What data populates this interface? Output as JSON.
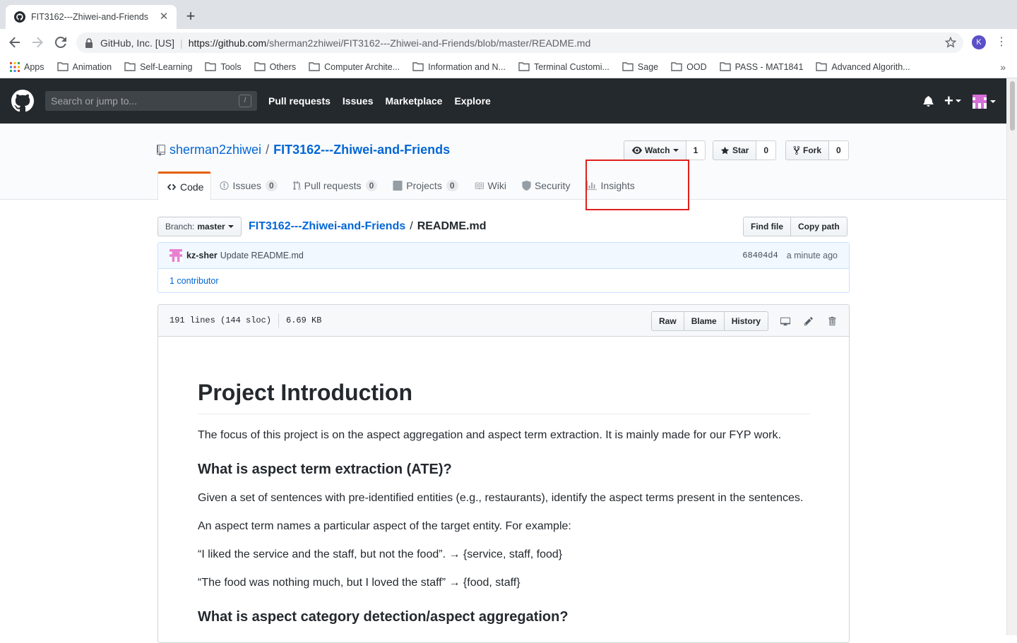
{
  "browser": {
    "tab_title": "FIT3162---Zhiwei-and-Friends",
    "url_org": "GitHub, Inc. [US]",
    "url_host": "https://github.com",
    "url_path": "/sherman2zhiwei/FIT3162---Zhiwei-and-Friends/blob/master/README.md",
    "profile_initial": "K",
    "bookmarks": [
      "Apps",
      "Animation",
      "Self-Learning",
      "Tools",
      "Others",
      "Computer Archite...",
      "Information and N...",
      "Terminal Customi...",
      "Sage",
      "OOD",
      "PASS - MAT1841",
      "Advanced Algorith..."
    ],
    "bookmarks_more": "»"
  },
  "github": {
    "search_placeholder": "Search or jump to...",
    "search_shortcut": "/",
    "nav": [
      "Pull requests",
      "Issues",
      "Marketplace",
      "Explore"
    ]
  },
  "repo": {
    "owner": "sherman2zhiwei",
    "name": "FIT3162---Zhiwei-and-Friends",
    "watch_label": "Watch",
    "watch_count": "1",
    "star_label": "Star",
    "star_count": "0",
    "fork_label": "Fork",
    "fork_count": "0",
    "tabs": [
      {
        "label": "Code",
        "count": null
      },
      {
        "label": "Issues",
        "count": "0"
      },
      {
        "label": "Pull requests",
        "count": "0"
      },
      {
        "label": "Projects",
        "count": "0"
      },
      {
        "label": "Wiki",
        "count": null
      },
      {
        "label": "Security",
        "count": null
      },
      {
        "label": "Insights",
        "count": null
      }
    ]
  },
  "filenav": {
    "branch_prefix": "Branch:",
    "branch": "master",
    "repo_link": "FIT3162---Zhiwei-and-Friends",
    "separator": "/",
    "file": "README.md",
    "find_file": "Find file",
    "copy_path": "Copy path"
  },
  "commit": {
    "author": "kz-sher",
    "message": "Update README.md",
    "sha": "68404d4",
    "time": "a minute ago",
    "contributors": "1 contributor"
  },
  "file": {
    "lines": "191 lines (144 sloc)",
    "size": "6.69 KB",
    "raw": "Raw",
    "blame": "Blame",
    "history": "History"
  },
  "readme": {
    "h1": "Project Introduction",
    "p1": "The focus of this project is on the aspect aggregation and aspect term extraction. It is mainly made for our FYP work.",
    "h3a": "What is aspect term extraction (ATE)?",
    "p2": "Given a set of sentences with pre-identified entities (e.g., restaurants), identify the aspect terms present in the sentences.",
    "p3": "An aspect term names a particular aspect of the target entity. For example:",
    "p4": "“I liked the service and the staff, but not the food”. → {service, staff, food}",
    "p5": "“The food was nothing much, but I loved the staff” → {food, staff}",
    "h3b": "What is aspect category detection/aspect aggregation?"
  },
  "colors": {
    "header_bg": "#24292e",
    "link": "#0366d6",
    "selected_tab_accent": "#e36209",
    "highlight_box": "#e0201b"
  }
}
